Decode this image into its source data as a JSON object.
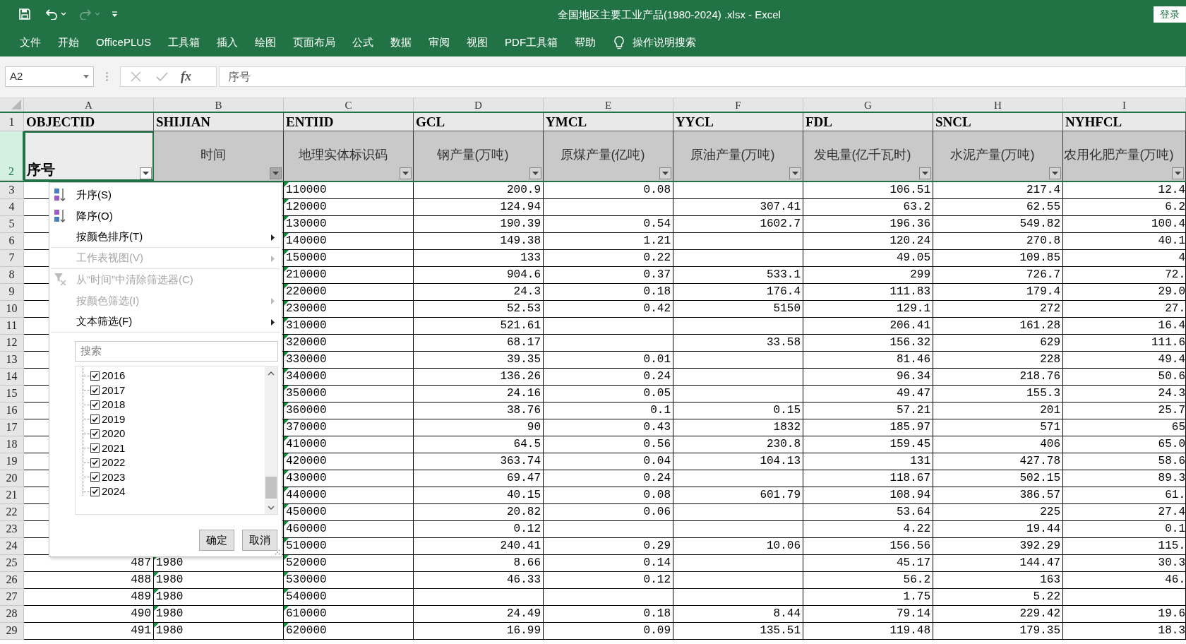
{
  "title_bar": {
    "title": "全国地区主要工业产品(1980-2024) .xlsx - Excel",
    "login_button": "登录",
    "redo_disabled": true
  },
  "ribbon_tabs": [
    {
      "label": "文件"
    },
    {
      "label": "开始"
    },
    {
      "label": "OfficePLUS"
    },
    {
      "label": "工具箱"
    },
    {
      "label": "插入"
    },
    {
      "label": "绘图"
    },
    {
      "label": "页面布局"
    },
    {
      "label": "公式"
    },
    {
      "label": "数据"
    },
    {
      "label": "审阅"
    },
    {
      "label": "视图"
    },
    {
      "label": "PDF工具箱"
    },
    {
      "label": "帮助"
    }
  ],
  "tell_me": "操作说明搜索",
  "formula_bar": {
    "name_box": "A2",
    "fx_label": "fx",
    "formula": "序号"
  },
  "sheet": {
    "columns": [
      {
        "letter": "A",
        "kind": "number"
      },
      {
        "letter": "B",
        "kind": "text"
      },
      {
        "letter": "C",
        "kind": "text"
      },
      {
        "letter": "D",
        "kind": "number"
      },
      {
        "letter": "E",
        "kind": "number"
      },
      {
        "letter": "F",
        "kind": "number"
      },
      {
        "letter": "G",
        "kind": "number"
      },
      {
        "letter": "H",
        "kind": "number"
      },
      {
        "letter": "I",
        "kind": "number"
      }
    ],
    "field_row": {
      "number": "1",
      "selected": false,
      "cells": [
        "OBJECTID",
        "SHIJIAN",
        "ENTIID",
        "GCL",
        "YMCL",
        "YYCL",
        "FDL",
        "SNCL",
        "NYHFCL"
      ]
    },
    "title_row": {
      "number": "2",
      "selected": true,
      "cells": [
        {
          "text": "序号",
          "selected": true,
          "filter_open": false
        },
        {
          "text": "时间",
          "selected": false,
          "filter_open": true
        },
        {
          "text": "地理实体标识码",
          "selected": false,
          "filter_open": false
        },
        {
          "text": "钢产量(万吨)",
          "selected": false,
          "filter_open": false
        },
        {
          "text": "原煤产量(亿吨)",
          "selected": false,
          "filter_open": false
        },
        {
          "text": "原油产量(万吨)",
          "selected": false,
          "filter_open": false
        },
        {
          "text": "发电量(亿千瓦时)",
          "selected": false,
          "filter_open": false
        },
        {
          "text": "水泥产量(万吨)",
          "selected": false,
          "filter_open": false
        },
        {
          "text": "农用化肥产量(万吨)",
          "selected": false,
          "filter_open": false
        }
      ]
    },
    "rows": [
      {
        "number": "3",
        "cells": [
          null,
          null,
          "110000",
          "200.9",
          "0.08",
          null,
          "106.51",
          "217.4",
          "12.4"
        ]
      },
      {
        "number": "4",
        "cells": [
          null,
          null,
          "120000",
          "124.94",
          null,
          "307.41",
          "63.2",
          "62.55",
          "6.2"
        ]
      },
      {
        "number": "5",
        "cells": [
          null,
          null,
          "130000",
          "190.39",
          "0.54",
          "1602.7",
          "196.36",
          "549.82",
          "100.4"
        ]
      },
      {
        "number": "6",
        "cells": [
          null,
          null,
          "140000",
          "149.38",
          "1.21",
          null,
          "120.24",
          "270.8",
          "40.1"
        ]
      },
      {
        "number": "7",
        "cells": [
          null,
          null,
          "150000",
          "133",
          "0.22",
          null,
          "49.05",
          "109.85",
          "4"
        ]
      },
      {
        "number": "8",
        "cells": [
          null,
          null,
          "210000",
          "904.6",
          "0.37",
          "533.1",
          "299",
          "726.7",
          "72."
        ]
      },
      {
        "number": "9",
        "cells": [
          null,
          null,
          "220000",
          "24.3",
          "0.18",
          "176.4",
          "111.83",
          "179.4",
          "29.0"
        ]
      },
      {
        "number": "10",
        "cells": [
          null,
          null,
          "230000",
          "52.53",
          "0.42",
          "5150",
          "129.1",
          "272",
          "27."
        ]
      },
      {
        "number": "11",
        "cells": [
          null,
          null,
          "310000",
          "521.61",
          null,
          null,
          "206.41",
          "161.28",
          "16.4"
        ]
      },
      {
        "number": "12",
        "cells": [
          null,
          null,
          "320000",
          "68.17",
          null,
          "33.58",
          "156.32",
          "629",
          "111.6"
        ]
      },
      {
        "number": "13",
        "cells": [
          null,
          null,
          "330000",
          "39.35",
          "0.01",
          null,
          "81.46",
          "228",
          "49.4"
        ]
      },
      {
        "number": "14",
        "cells": [
          null,
          null,
          "340000",
          "136.26",
          "0.24",
          null,
          "96.34",
          "218.76",
          "50.6"
        ]
      },
      {
        "number": "15",
        "cells": [
          null,
          null,
          "350000",
          "24.16",
          "0.05",
          null,
          "49.47",
          "155.3",
          "24.3"
        ]
      },
      {
        "number": "16",
        "cells": [
          null,
          null,
          "360000",
          "38.76",
          "0.1",
          "0.15",
          "57.21",
          "201",
          "25.7"
        ]
      },
      {
        "number": "17",
        "cells": [
          null,
          null,
          "370000",
          "90",
          "0.43",
          "1832",
          "185.97",
          "571",
          "65"
        ]
      },
      {
        "number": "18",
        "cells": [
          null,
          null,
          "410000",
          "64.5",
          "0.56",
          "230.8",
          "159.45",
          "406",
          "65.0"
        ]
      },
      {
        "number": "19",
        "cells": [
          null,
          null,
          "420000",
          "363.74",
          "0.04",
          "104.13",
          "131",
          "427.78",
          "58.6"
        ]
      },
      {
        "number": "20",
        "cells": [
          null,
          null,
          "430000",
          "69.47",
          "0.24",
          null,
          "118.67",
          "502.15",
          "89.3"
        ]
      },
      {
        "number": "21",
        "cells": [
          null,
          null,
          "440000",
          "40.15",
          "0.08",
          "601.79",
          "108.94",
          "386.57",
          "61."
        ]
      },
      {
        "number": "22",
        "cells": [
          null,
          null,
          "450000",
          "20.82",
          "0.06",
          null,
          "53.64",
          "225",
          "27.4"
        ]
      },
      {
        "number": "23",
        "cells": [
          null,
          null,
          "460000",
          "0.12",
          null,
          null,
          "4.22",
          "19.44",
          "0.1"
        ]
      },
      {
        "number": "24",
        "cells": [
          null,
          null,
          "510000",
          "240.41",
          "0.29",
          "10.06",
          "156.56",
          "392.29",
          "115."
        ]
      },
      {
        "number": "25",
        "cells": [
          "487",
          "1980",
          "520000",
          "8.66",
          "0.14",
          null,
          "45.17",
          "144.47",
          "30.3"
        ]
      },
      {
        "number": "26",
        "cells": [
          "488",
          "1980",
          "530000",
          "46.33",
          "0.12",
          null,
          "56.2",
          "163",
          "46."
        ]
      },
      {
        "number": "27",
        "cells": [
          "489",
          "1980",
          "540000",
          null,
          null,
          null,
          "1.75",
          "5.22",
          null
        ]
      },
      {
        "number": "28",
        "cells": [
          "490",
          "1980",
          "610000",
          "24.49",
          "0.18",
          "8.44",
          "79.14",
          "229.42",
          "19.6"
        ]
      },
      {
        "number": "29",
        "cells": [
          "491",
          "1980",
          "620000",
          "16.99",
          "0.09",
          "135.51",
          "119.48",
          "179.35",
          "18.3"
        ]
      }
    ]
  },
  "filter_menu": {
    "items": [
      {
        "kind": "sort_asc",
        "label": "升序(S)",
        "disabled": false,
        "submenu": false,
        "separator_after": false
      },
      {
        "kind": "sort_desc",
        "label": "降序(O)",
        "disabled": false,
        "submenu": false,
        "separator_after": false
      },
      {
        "kind": "plain",
        "label": "按颜色排序(T)",
        "disabled": false,
        "submenu": true,
        "separator_after": true
      },
      {
        "kind": "plain",
        "label": "工作表视图(V)",
        "disabled": true,
        "submenu": true,
        "separator_after": true
      },
      {
        "kind": "clear_filter",
        "label": "从“时间”中清除筛选器(C)",
        "disabled": true,
        "submenu": false,
        "separator_after": false
      },
      {
        "kind": "plain",
        "label": "按颜色筛选(I)",
        "disabled": true,
        "submenu": true,
        "separator_after": false
      },
      {
        "kind": "plain",
        "label": "文本筛选(F)",
        "disabled": false,
        "submenu": true,
        "separator_after": true
      }
    ],
    "search_placeholder": "搜索",
    "values": [
      {
        "label": "2016",
        "checked": true
      },
      {
        "label": "2017",
        "checked": true
      },
      {
        "label": "2018",
        "checked": true
      },
      {
        "label": "2019",
        "checked": true
      },
      {
        "label": "2020",
        "checked": true
      },
      {
        "label": "2021",
        "checked": true
      },
      {
        "label": "2022",
        "checked": true
      },
      {
        "label": "2023",
        "checked": true
      },
      {
        "label": "2024",
        "checked": true
      }
    ],
    "buttons": [
      "确定",
      "取消"
    ]
  }
}
